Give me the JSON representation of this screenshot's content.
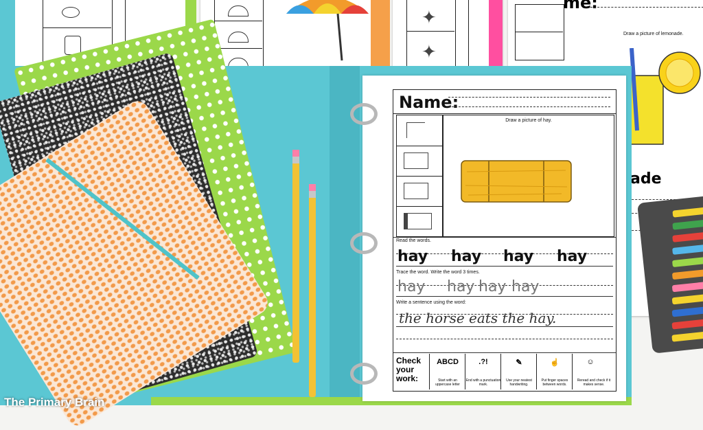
{
  "brand": "The Primary Brain",
  "worksheet_right": {
    "name_label_partial": "me:",
    "instruction": "Draw a picture of lemonade.",
    "word_partial": "ade"
  },
  "worksheet": {
    "name_label": "Name:",
    "draw_instruction": "Draw a picture of hay.",
    "read_label": "Read the words.",
    "read_words": [
      "hay",
      "hay",
      "hay",
      "hay"
    ],
    "trace_label": "Trace the word. Write the word 3 times.",
    "trace_words": [
      "hay",
      "hay",
      "hay",
      "hay"
    ],
    "sentence_label": "Write a sentence using the word:",
    "sentence": "the horse eats the hay.",
    "check_label": "Check your work:",
    "checks": [
      {
        "icon": "ABCD",
        "caption": "Start with an uppercase letter"
      },
      {
        "icon": ".?!",
        "caption": "End with a punctuation mark."
      },
      {
        "icon": "✎",
        "caption": "Use your neatest handwriting."
      },
      {
        "icon": "☝",
        "caption": "Put finger spaces between words."
      },
      {
        "icon": "☺",
        "caption": "Reread and check if it makes sense."
      }
    ]
  },
  "colors": {
    "binder": "#5bc7d3",
    "green_folder": "#9bd84a",
    "pouch": "#f5a061",
    "pencil": "#f2c234",
    "hay": "#f2b928"
  }
}
